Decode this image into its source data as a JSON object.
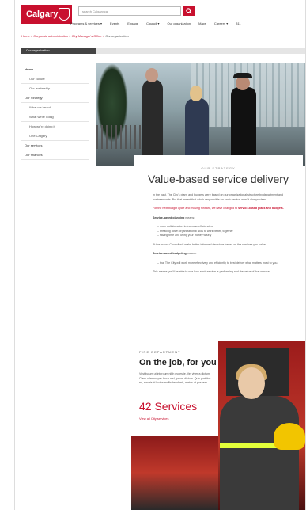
{
  "header": {
    "logo_text": "Calgary",
    "search_placeholder": "search Calgary.ca",
    "nav": [
      "Programs & services ▾",
      "Events",
      "Engage",
      "Council ▾",
      "Our organization",
      "Maps",
      "Careers ▾",
      "311"
    ]
  },
  "breadcrumb": {
    "links": [
      "Home",
      "Corporate administration",
      "City Manager's Office"
    ],
    "current": "Our organization"
  },
  "section_label": "Our organization",
  "sidebar": {
    "items": [
      {
        "label": "Home",
        "sub": false
      },
      {
        "label": "Our culture",
        "sub": true
      },
      {
        "label": "Our leadership",
        "sub": true
      },
      {
        "label": "Our Strategy",
        "sub": false
      },
      {
        "label": "What we heard",
        "sub": true
      },
      {
        "label": "What we're doing",
        "sub": true
      },
      {
        "label": "How we're doing it",
        "sub": true
      },
      {
        "label": "One Calgary",
        "sub": true
      },
      {
        "label": "Our services",
        "sub": false
      },
      {
        "label": "Our finances",
        "sub": false
      }
    ]
  },
  "strategy": {
    "eyebrow": "OUR STRATEGY",
    "title": "Value-based service delivery",
    "p1": "In the past, The City's plans and budgets were based on our organizational structure by department and business units. But that meant that who's responsible for each service wasn't always clear.",
    "p2_pre": "For the next budget cycle and moving forward, we have changed to ",
    "p2_link": "service-based plans and budgets.",
    "planning_label": "Service-based planning",
    "planning_suffix": " means:",
    "planning_items": [
      "more collaboration to increase efficiencies",
      "breaking down organizational silos to work better, together",
      "saving time and using your money wisely"
    ],
    "p3": "At the macro Council will make better-informed decisions based on the services you value.",
    "budgeting_label": "Service-based budgeting",
    "budgeting_suffix": " means:",
    "budgeting_items": [
      "that The City will work more effectively and efficiently to best deliver what matters most to you."
    ],
    "p4": "This means you'll be able to see how each service is performing and the value of that service."
  },
  "fire": {
    "eyebrow": "FIRE DEPARTMENT",
    "title": "On the job, for you",
    "body": "Vestibulum ut interdum nibh molestie. Vel viverra dictum. Class ullamcorper lacus nisl, ipsum dictum. Quis porttitor ex, mauris id luctus mollis hendrerit, metus ut posuere.",
    "count": "42 Services",
    "link": "View all City services"
  },
  "colors": {
    "brand_red": "#c8102e",
    "section_bar": "#444444"
  }
}
